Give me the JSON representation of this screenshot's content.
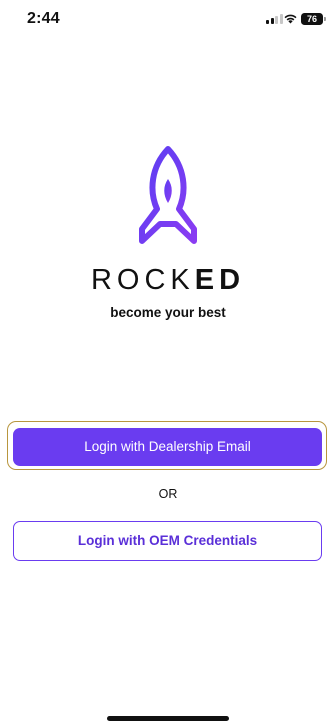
{
  "status_bar": {
    "time": "2:44",
    "battery": "76",
    "icons": [
      "signal-icon",
      "wifi-icon",
      "battery-icon"
    ]
  },
  "brand": {
    "wordmark_light": "ROCK",
    "wordmark_bold": "ED",
    "tagline": "become your best",
    "accent_color": "#6a3cf0"
  },
  "login": {
    "primary_label": "Login with Dealership Email",
    "separator": "OR",
    "secondary_label": "Login with OEM Credentials"
  }
}
